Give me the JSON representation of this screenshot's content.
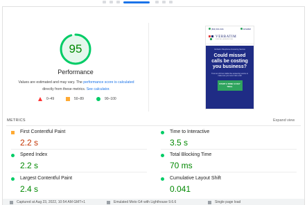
{
  "score": {
    "value": "95",
    "fraction": 0.95,
    "title": "Performance",
    "color": "#0c6",
    "text_color": "#080",
    "track_color": "#e5f7ec"
  },
  "note": {
    "text_1": "Values are estimated and may vary. The",
    "link_1": "performance score is calculated",
    "text_2": "directly from these metrics.",
    "link_2": "See calculator."
  },
  "legend": [
    {
      "range": "0–49",
      "color": "#ff3333",
      "shape": "triangle"
    },
    {
      "range": "50–89",
      "color": "#ffaa33",
      "shape": "square"
    },
    {
      "range": "90–100",
      "color": "#00cc66",
      "shape": "circle"
    }
  ],
  "screenshot": {
    "phone_left": "(800) 600-0101",
    "phone_right": "ANSWER",
    "brand": "VERBATIM",
    "brand_sub": "DIGITAL ANSWERING",
    "strip": "Verbatim Telephone Answering Service",
    "headline": "Could missed calls be costing you business?",
    "body": "Trust our 24 hour staffed live answering service to make sure you never miss a call",
    "cta": "START A FREE 14 DAY TRIAL"
  },
  "metrics_section": {
    "label": "METRICS",
    "expand": "Expand view"
  },
  "metrics": [
    {
      "name": "First Contentful Paint",
      "value": "2.2 s",
      "status": "average"
    },
    {
      "name": "Time to Interactive",
      "value": "3.5 s",
      "status": "pass"
    },
    {
      "name": "Speed Index",
      "value": "2.2 s",
      "status": "pass"
    },
    {
      "name": "Total Blocking Time",
      "value": "70 ms",
      "status": "pass"
    },
    {
      "name": "Largest Contentful Paint",
      "value": "2.4 s",
      "status": "pass"
    },
    {
      "name": "Cumulative Layout Shift",
      "value": "0.041",
      "status": "pass"
    }
  ],
  "footer": {
    "captured": "Captured at Aug 23, 2022, 10:54 AM GMT+1",
    "device": "Emulated Moto G4 with Lighthouse 9.6.6",
    "load": "Single page load"
  }
}
